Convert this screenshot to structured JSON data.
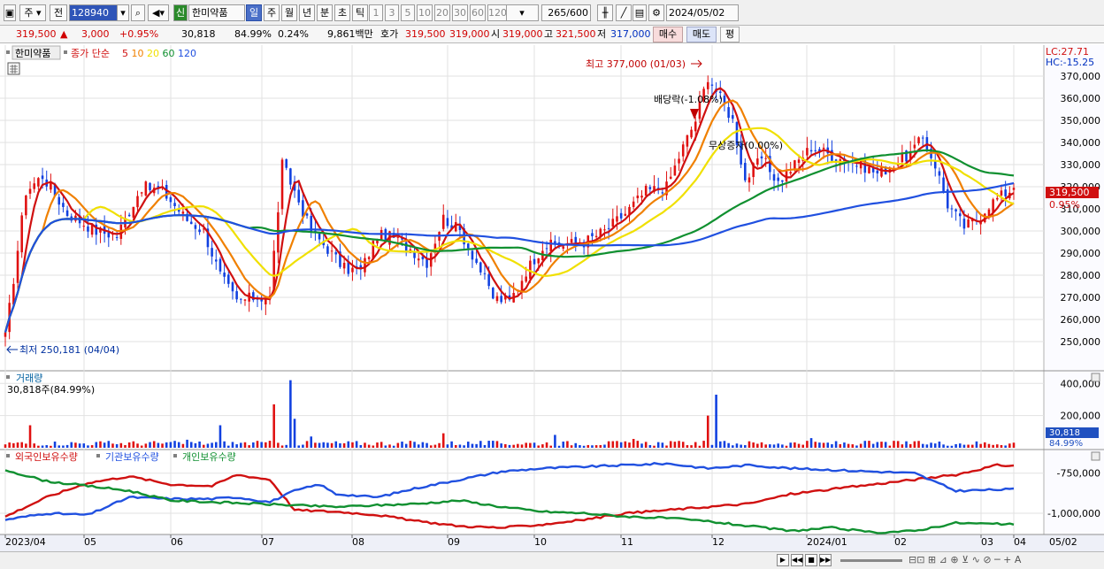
{
  "toolbar": {
    "period_label": "주",
    "prev_label": "전",
    "code": "128940",
    "new_badge": "신",
    "stock_name": "한미약품",
    "period_tabs": [
      "일",
      "주",
      "월",
      "년",
      "분",
      "초",
      "틱"
    ],
    "selected_tab": "일",
    "intervals": [
      "1",
      "3",
      "5",
      "10",
      "20",
      "30",
      "60",
      "120"
    ],
    "count": "265",
    "count_total": "/600",
    "date": "2024/05/02"
  },
  "quote": {
    "price": "319,500",
    "change": "3,000",
    "change_pct": "+0.95%",
    "volume": "30,818",
    "vol_pct": "84.99%",
    "turnover_pct": "0.24%",
    "amount": "9,861백만",
    "bid_label": "호가",
    "bid": "319,500",
    "ask": "319,000",
    "open_label": "시",
    "open": "319,000",
    "high_label": "고",
    "high": "321,500",
    "low_label": "저",
    "low": "317,000",
    "sell_btn": "매수",
    "buy_btn": "매도",
    "eval_btn": "평"
  },
  "price_panel": {
    "stock_name": "한미약품",
    "ma_label": "종가 단순",
    "ma_periods": [
      "5",
      "10",
      "20",
      "60",
      "120"
    ],
    "ma_colors": [
      "#d01010",
      "#f08000",
      "#f0e000",
      "#109030",
      "#2050e0"
    ],
    "lc": "LC:27.71",
    "hc": "HC:-15.25",
    "current_price": "319,500",
    "current_pct": "0.95%",
    "max_label": "최고 377,000 (01/03)",
    "min_label": "최저 250,181 (04/04)",
    "event_dividend": "배당락(-1.08%)",
    "event_bonus": "무상증자(0.00%)"
  },
  "volume_panel": {
    "label": "거래량",
    "sub": "30,818주(84.99%)",
    "current": "30,818",
    "current_pct": "84.99%"
  },
  "holding_panel": {
    "labels": [
      "외국인보유수량",
      "기관보유수량",
      "개인보유수량"
    ],
    "colors": [
      "#d01010",
      "#2050e0",
      "#109030"
    ]
  },
  "x_labels": [
    "2023/04",
    "05",
    "06",
    "07",
    "08",
    "09",
    "10",
    "11",
    "12",
    "2024/01",
    "02",
    "03",
    "04",
    "05",
    "05/02"
  ],
  "chart_data": {
    "type": "candlestick",
    "price_axis": {
      "min": 240000,
      "max": 380000,
      "ticks": [
        "370,000",
        "360,000",
        "350,000",
        "340,000",
        "330,000",
        "320,000",
        "310,000",
        "300,000",
        "290,000",
        "280,000",
        "270,000",
        "260,000",
        "250,000"
      ]
    },
    "volume_axis": {
      "ticks": [
        "400,000",
        "200,000"
      ]
    },
    "holding_axis": {
      "ticks": [
        "-750,000",
        "-1,000,000"
      ]
    },
    "close_anchors": [
      [
        0,
        252000
      ],
      [
        5,
        318000
      ],
      [
        9,
        325000
      ],
      [
        15,
        308000
      ],
      [
        22,
        300000
      ],
      [
        27,
        298000
      ],
      [
        33,
        320000
      ],
      [
        38,
        318000
      ],
      [
        44,
        305000
      ],
      [
        48,
        300000
      ],
      [
        52,
        280000
      ],
      [
        56,
        268000
      ],
      [
        60,
        270000
      ],
      [
        64,
        270000
      ],
      [
        67,
        330000
      ],
      [
        70,
        318000
      ],
      [
        74,
        300000
      ],
      [
        78,
        292000
      ],
      [
        82,
        283000
      ],
      [
        86,
        282000
      ],
      [
        90,
        298000
      ],
      [
        94,
        297000
      ],
      [
        98,
        292000
      ],
      [
        102,
        286000
      ],
      [
        106,
        306000
      ],
      [
        110,
        300000
      ],
      [
        114,
        286000
      ],
      [
        118,
        270000
      ],
      [
        122,
        268000
      ],
      [
        126,
        282000
      ],
      [
        130,
        293000
      ],
      [
        135,
        294000
      ],
      [
        140,
        295000
      ],
      [
        145,
        300000
      ],
      [
        150,
        308000
      ],
      [
        155,
        318000
      ],
      [
        160,
        320000
      ],
      [
        164,
        338000
      ],
      [
        167,
        350000
      ],
      [
        170,
        370000
      ],
      [
        173,
        360000
      ],
      [
        176,
        350000
      ],
      [
        179,
        323000
      ],
      [
        183,
        333000
      ],
      [
        187,
        322000
      ],
      [
        191,
        330000
      ],
      [
        195,
        338000
      ],
      [
        199,
        335000
      ],
      [
        203,
        332000
      ],
      [
        207,
        330000
      ],
      [
        211,
        326000
      ],
      [
        215,
        330000
      ],
      [
        219,
        335000
      ],
      [
        222,
        342000
      ],
      [
        225,
        330000
      ],
      [
        228,
        312000
      ],
      [
        232,
        302000
      ],
      [
        235,
        305000
      ],
      [
        238,
        312000
      ],
      [
        241,
        316000
      ],
      [
        244,
        319500
      ]
    ],
    "volume_spikes": [
      [
        6,
        140000
      ],
      [
        44,
        50000
      ],
      [
        52,
        140000
      ],
      [
        65,
        270000
      ],
      [
        69,
        420000
      ],
      [
        70,
        180000
      ],
      [
        74,
        70000
      ],
      [
        106,
        90000
      ],
      [
        133,
        80000
      ],
      [
        152,
        55000
      ],
      [
        170,
        200000
      ],
      [
        172,
        330000
      ],
      [
        195,
        60000
      ]
    ],
    "holding": {
      "foreign": [
        [
          0,
          -1020000
        ],
        [
          10,
          -900000
        ],
        [
          20,
          -810000
        ],
        [
          30,
          -770000
        ],
        [
          40,
          -820000
        ],
        [
          50,
          -830000
        ],
        [
          56,
          -760000
        ],
        [
          64,
          -790000
        ],
        [
          70,
          -980000
        ],
        [
          80,
          -990000
        ],
        [
          90,
          -1010000
        ],
        [
          100,
          -1050000
        ],
        [
          110,
          -1080000
        ],
        [
          120,
          -1090000
        ],
        [
          130,
          -1070000
        ],
        [
          140,
          -1040000
        ],
        [
          150,
          -1000000
        ],
        [
          160,
          -980000
        ],
        [
          170,
          -960000
        ],
        [
          180,
          -940000
        ],
        [
          190,
          -880000
        ],
        [
          200,
          -850000
        ],
        [
          210,
          -820000
        ],
        [
          220,
          -790000
        ],
        [
          230,
          -760000
        ],
        [
          240,
          -700000
        ],
        [
          244,
          -705000
        ]
      ],
      "institution": [
        [
          0,
          -1040000
        ],
        [
          10,
          -1000000
        ],
        [
          20,
          -1010000
        ],
        [
          30,
          -900000
        ],
        [
          40,
          -910000
        ],
        [
          50,
          -910000
        ],
        [
          56,
          -900000
        ],
        [
          64,
          -930000
        ],
        [
          70,
          -860000
        ],
        [
          76,
          -820000
        ],
        [
          80,
          -880000
        ],
        [
          90,
          -900000
        ],
        [
          100,
          -840000
        ],
        [
          110,
          -790000
        ],
        [
          120,
          -740000
        ],
        [
          130,
          -720000
        ],
        [
          140,
          -710000
        ],
        [
          150,
          -700000
        ],
        [
          160,
          -690000
        ],
        [
          170,
          -720000
        ],
        [
          180,
          -700000
        ],
        [
          190,
          -720000
        ],
        [
          200,
          -730000
        ],
        [
          210,
          -740000
        ],
        [
          220,
          -750000
        ],
        [
          230,
          -860000
        ],
        [
          244,
          -850000
        ]
      ],
      "individual": [
        [
          0,
          -730000
        ],
        [
          10,
          -800000
        ],
        [
          20,
          -830000
        ],
        [
          30,
          -860000
        ],
        [
          40,
          -920000
        ],
        [
          50,
          -930000
        ],
        [
          60,
          -940000
        ],
        [
          70,
          -950000
        ],
        [
          80,
          -960000
        ],
        [
          90,
          -950000
        ],
        [
          100,
          -940000
        ],
        [
          110,
          -920000
        ],
        [
          120,
          -960000
        ],
        [
          130,
          -990000
        ],
        [
          140,
          -1000000
        ],
        [
          150,
          -1020000
        ],
        [
          160,
          -1030000
        ],
        [
          170,
          -1050000
        ],
        [
          180,
          -1080000
        ],
        [
          190,
          -1110000
        ],
        [
          200,
          -1090000
        ],
        [
          210,
          -1120000
        ],
        [
          220,
          -1110000
        ],
        [
          230,
          -1060000
        ],
        [
          244,
          -1070000
        ]
      ]
    }
  }
}
